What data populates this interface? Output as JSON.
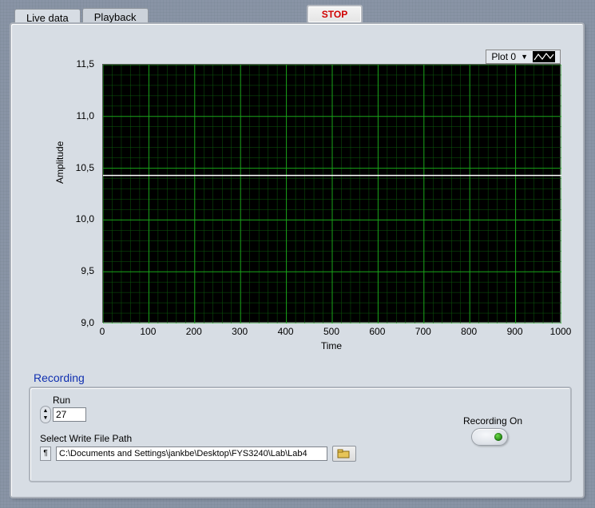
{
  "stop_label": "STOP",
  "tabs": {
    "live": "Live data",
    "playback": "Playback"
  },
  "legend": {
    "label": "Plot 0"
  },
  "recording": {
    "title": "Recording",
    "run_label": "Run",
    "run_value": "27",
    "path_label": "Select  Write File Path",
    "path_value": "C:\\Documents and Settings\\jankbe\\Desktop\\FYS3240\\Lab\\Lab4",
    "recording_on_label": "Recording On"
  },
  "chart_data": {
    "type": "line",
    "xlabel": "Time",
    "ylabel": "Amplitude",
    "xlim": [
      0,
      1000
    ],
    "ylim": [
      9.0,
      11.5
    ],
    "x_ticks": [
      0,
      100,
      200,
      300,
      400,
      500,
      600,
      700,
      800,
      900,
      1000
    ],
    "y_ticks": [
      9.0,
      9.5,
      10.0,
      10.5,
      11.0,
      11.5
    ],
    "y_tick_labels": [
      "9,0",
      "9,5",
      "10,0",
      "10,5",
      "11,0",
      "11,5"
    ],
    "series": [
      {
        "name": "Plot 0",
        "color": "#ffffff",
        "x": [
          0,
          1000
        ],
        "y": [
          10.43,
          10.43
        ]
      }
    ],
    "grid": {
      "major_color": "#1aa51a",
      "minor_color": "#0c5a0c",
      "minor_div": 5
    }
  }
}
